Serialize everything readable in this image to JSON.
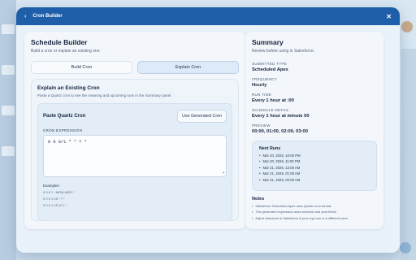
{
  "header": {
    "title": "Cron Builder",
    "back_icon": "‹",
    "close_icon": "✕"
  },
  "left": {
    "title": "Schedule Builder",
    "subtitle": "Build a cron or explain an existing one.",
    "tabs": [
      {
        "label": "Build Cron",
        "active": false
      },
      {
        "label": "Explain Cron",
        "active": true
      }
    ],
    "panel": {
      "title": "Explain an Existing Cron",
      "subtitle": "Paste a Quartz cron to see the meaning and upcoming runs in the Summary panel.",
      "section_title": "Paste Quartz Cron",
      "use_generated_label": "Use Generated Cron",
      "expression_label": "CRON EXPRESSION",
      "expression_value": "0 0 0/1 * * ? *",
      "examples_title": "Examples",
      "examples": [
        "0 0 9 ? * MON-WED *",
        "0 0 9 1,15 * ? *",
        "0 0 9 1,15 12 1 *"
      ]
    }
  },
  "summary": {
    "title": "Summary",
    "subtitle": "Review before using in Salesforce.",
    "fields": [
      {
        "label": "SUBMITTED TYPE",
        "value": "Scheduled Apex"
      },
      {
        "label": "FREQUENCY",
        "value": "Hourly"
      },
      {
        "label": "RUN TIME",
        "value": "Every 1 hour at :00"
      },
      {
        "label": "SCHEDULE DETAIL",
        "value": "Every 1 hour at minute 00"
      },
      {
        "label": "PREVIEW",
        "value": "00:00, 01:00, 02:00, 03:00"
      }
    ],
    "next_runs_title": "Next Runs",
    "next_runs": [
      "Mar 20, 2026, 10:00 PM",
      "Mar 20, 2026, 11:00 PM",
      "Mar 21, 2026, 12:00 AM",
      "Mar 21, 2026, 01:00 AM",
      "Mar 21, 2026, 02:00 AM"
    ],
    "notes_title": "Notes",
    "notes": [
      "Salesforce Scheduled Apex uses Quartz cron format.",
      "The generated expression uses seconds and year fields.",
      "Adjust timezone in Salesforce if your org runs in a different zone."
    ]
  }
}
